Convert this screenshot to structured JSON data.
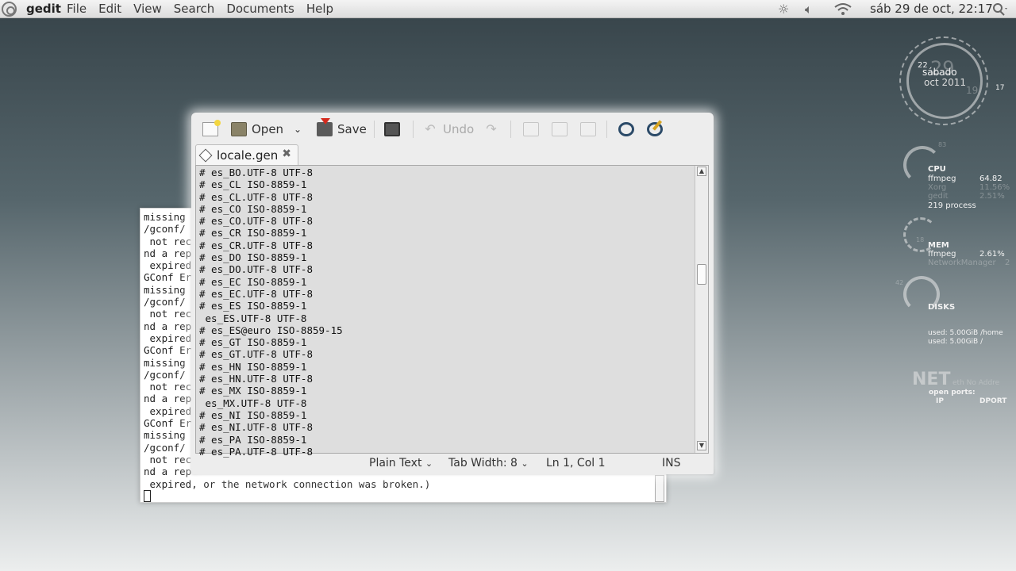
{
  "topbar": {
    "app_name": "gedit",
    "menu": [
      "File",
      "Edit",
      "View",
      "Search",
      "Documents",
      "Help"
    ],
    "clock": "sáb 29 de oct, 22:17",
    "icons": [
      "brightness-icon",
      "volume-icon",
      "wifi-icon",
      "power-icon"
    ]
  },
  "gedit": {
    "toolbar": {
      "open_label": "Open",
      "save_label": "Save",
      "undo_label": "Undo"
    },
    "tab": {
      "title": "locale.gen"
    },
    "lines": [
      "# es_BO.UTF-8 UTF-8",
      "# es_CL ISO-8859-1",
      "# es_CL.UTF-8 UTF-8",
      "# es_CO ISO-8859-1",
      "# es_CO.UTF-8 UTF-8",
      "# es_CR ISO-8859-1",
      "# es_CR.UTF-8 UTF-8",
      "# es_DO ISO-8859-1",
      "# es_DO.UTF-8 UTF-8",
      "# es_EC ISO-8859-1",
      "# es_EC.UTF-8 UTF-8",
      "# es_ES ISO-8859-1",
      " es_ES.UTF-8 UTF-8",
      "# es_ES@euro ISO-8859-15",
      "# es_GT ISO-8859-1",
      "# es_GT.UTF-8 UTF-8",
      "# es_HN ISO-8859-1",
      "# es_HN.UTF-8 UTF-8",
      "# es_MX ISO-8859-1",
      " es_MX.UTF-8 UTF-8",
      "# es_NI ISO-8859-1",
      "# es_NI.UTF-8 UTF-8",
      "# es_PA ISO-8859-1",
      "# es_PA.UTF-8 UTF-8"
    ],
    "status": {
      "language": "Plain Text",
      "tab_width": "Tab Width:  8",
      "position": "Ln 1, Col 1",
      "mode": "INS"
    }
  },
  "terminal": {
    "lines": [
      "missing",
      "/gconf/",
      " not rec",
      "nd a rep",
      " expired",
      "GConf Er",
      "missing",
      "/gconf/",
      " not rec",
      "nd a rep",
      " expired",
      "GConf Er",
      "missing",
      "/gconf/",
      " not rec",
      "nd a rep",
      " expired",
      "GConf Er",
      "missing",
      "/gconf/",
      " not rec",
      "nd a rep",
      " expired, or the network connection was broken.)"
    ]
  },
  "conky": {
    "clock": {
      "hour": "22",
      "day_big": "29",
      "day_name": "sábado",
      "month_year": "oct 2011",
      "minute": "19",
      "second": "17"
    },
    "cpu": {
      "label": "CPU",
      "top_value": "83",
      "procs": [
        {
          "name": "ffmpeg",
          "value": "64.82"
        },
        {
          "name": "Xorg",
          "value": "11.56%"
        },
        {
          "name": "gedit",
          "value": "2.51%"
        }
      ],
      "process_count": "219 process"
    },
    "mem": {
      "label": "MEM",
      "value": "18",
      "procs": [
        {
          "name": "ffmpeg",
          "value": "2.61%"
        },
        {
          "name": "NetworkManager",
          "value": "2"
        }
      ]
    },
    "disks": {
      "label": "DISKS",
      "value": "42",
      "lines": [
        "used: 5.00GiB /home",
        "used: 5.00GiB /"
      ]
    },
    "net": {
      "label": "NET",
      "iface": "eth No Addre",
      "ports": "open ports:",
      "ip": "IP",
      "dport": "DPORT"
    }
  }
}
